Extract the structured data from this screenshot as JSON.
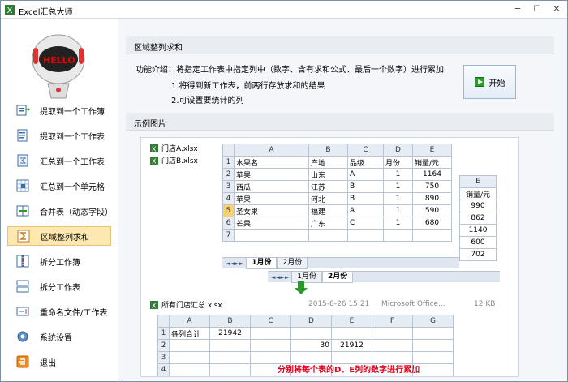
{
  "window": {
    "title": "Excel汇总大师",
    "min_label": "─",
    "max_label": "☐",
    "close_label": "✕"
  },
  "sidebar": {
    "logo_text": "HELLO",
    "items": [
      {
        "label": "提取到一个工作簿",
        "icon": "workbook-extract-icon"
      },
      {
        "label": "提取到一个工作表",
        "icon": "sheet-extract-icon"
      },
      {
        "label": "汇总到一个工作表",
        "icon": "sheet-summary-icon"
      },
      {
        "label": "汇总到一个单元格",
        "icon": "cell-summary-icon"
      },
      {
        "label": "合并表（动态字段）",
        "icon": "merge-icon"
      },
      {
        "label": "区域整列求和",
        "icon": "column-sum-icon",
        "active": true
      },
      {
        "label": "拆分工作簿",
        "icon": "split-workbook-icon"
      },
      {
        "label": "拆分工作表",
        "icon": "split-sheet-icon"
      },
      {
        "label": "重命名文件/工作表",
        "icon": "rename-icon"
      },
      {
        "label": "系统设置",
        "icon": "settings-icon"
      },
      {
        "label": "退出",
        "icon": "exit-icon"
      }
    ]
  },
  "main": {
    "section_title": "区域整列求和",
    "intro": "功能介绍：将指定工作表中指定列中（数字、含有求和公式、最后一个数字）进行累加",
    "notes": [
      "1.将得到新工作表，前两行存放求和的结果",
      "2.可设置要统计的列"
    ],
    "start_label": "开始",
    "example_title": "示例图片"
  },
  "example": {
    "files": [
      "门店A.xlsx",
      "门店B.xlsx"
    ],
    "sheet1": {
      "col_headers": [
        "",
        "A",
        "B",
        "C",
        "D",
        "E"
      ],
      "rows": [
        [
          "1",
          "水果名",
          "产地",
          "品级",
          "月份",
          "销量/元"
        ],
        [
          "2",
          "苹果",
          "山东",
          "A",
          "1",
          "1164"
        ],
        [
          "3",
          "西瓜",
          "江苏",
          "B",
          "1",
          "750"
        ],
        [
          "4",
          "苹果",
          "河北",
          "B",
          "1",
          "890"
        ],
        [
          "5",
          "圣女果",
          "福建",
          "A",
          "1",
          "590"
        ],
        [
          "6",
          "芒果",
          "广东",
          "C",
          "1",
          "680"
        ],
        [
          "7",
          "",
          "",
          "",
          "",
          ""
        ]
      ],
      "tabs": [
        "1月份",
        "2月份"
      ]
    },
    "sheet2": {
      "col_header": "E",
      "header": "销量/元",
      "values": [
        "990",
        "862",
        "1140",
        "600",
        "702"
      ],
      "tabs": [
        "1月份",
        "2月份"
      ]
    },
    "result_file": {
      "name": "所有门店汇总.xlsx",
      "date": "2015-8-26 15:21",
      "type": "Microsoft Office...",
      "size": "12 KB"
    },
    "result_sheet": {
      "col_headers": [
        "",
        "A",
        "B",
        "C",
        "D",
        "E",
        "F",
        "G"
      ],
      "rows": [
        [
          "1",
          "各列合计",
          "21942",
          "",
          "",
          "",
          "",
          ""
        ],
        [
          "2",
          "",
          "",
          "",
          "30",
          "21912",
          "",
          ""
        ],
        [
          "3",
          "",
          "",
          "",
          "",
          "",
          "",
          ""
        ],
        [
          "4",
          "",
          "",
          "",
          "",
          "",
          "",
          ""
        ]
      ]
    },
    "caption": "分别将每个表的D、E列的数字进行累加"
  },
  "colors": {
    "accent": "#fde8b0",
    "caption": "#e0001b",
    "start_green": "#2a9a2a"
  }
}
